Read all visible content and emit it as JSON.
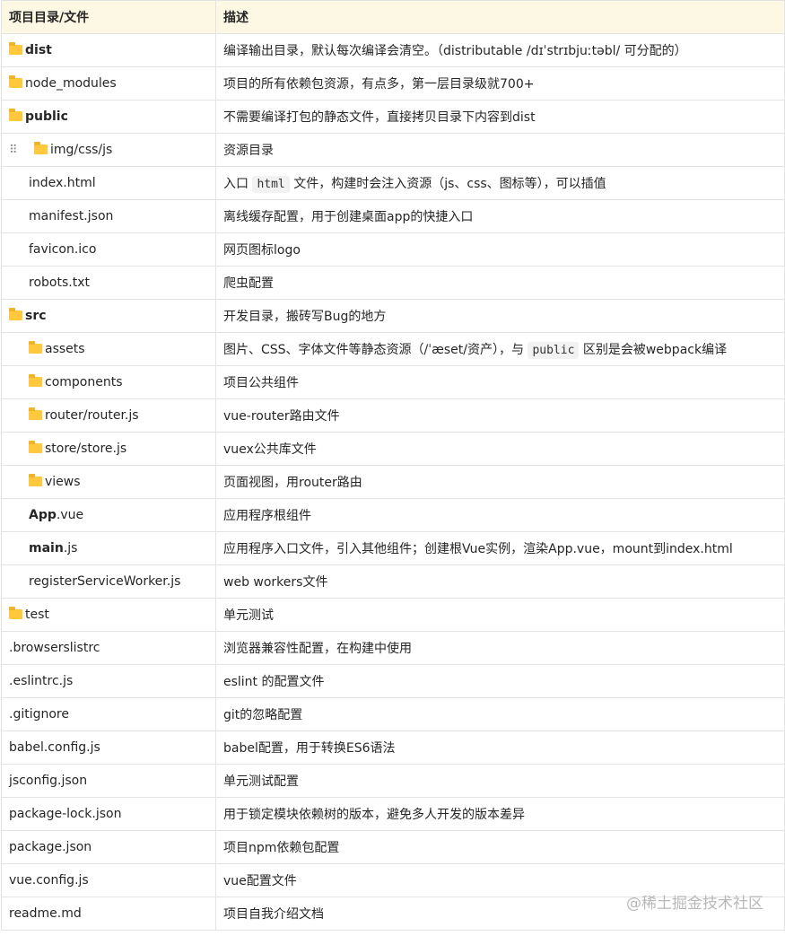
{
  "header": {
    "col1": "项目目录/文件",
    "col2": "描述"
  },
  "rows": [
    {
      "name": "dist",
      "desc": "编译输出目录，默认每次编译会清空。（distributable /dɪˈstrɪbjuːtəbl/ 可分配的）"
    },
    {
      "name": "node_modules",
      "desc": "项目的所有依赖包资源，有点多，第一层目录级就700+"
    },
    {
      "name": "public",
      "desc": "不需要编译打包的静态文件，直接拷贝目录下内容到dist"
    },
    {
      "name": "img/css/js",
      "desc": "资源目录"
    },
    {
      "name": "index.html",
      "desc_a": "入口",
      "desc_code": "html",
      "desc_b": "文件，构建时会注入资源（js、css、图标等），可以插值"
    },
    {
      "name": "manifest.json",
      "desc": "离线缓存配置，用于创建桌面app的快捷入口"
    },
    {
      "name": "favicon.ico",
      "desc": "网页图标logo"
    },
    {
      "name": "robots.txt",
      "desc": "爬虫配置"
    },
    {
      "name": "src",
      "desc": "开发目录，搬砖写Bug的地方"
    },
    {
      "name": "assets",
      "desc_a": "图片、CSS、字体文件等静态资源（/ˈæset/资产），与",
      "desc_code": "public",
      "desc_b": "区别是会被webpack编译"
    },
    {
      "name": "components",
      "desc": "项目公共组件"
    },
    {
      "name": "router/router.js",
      "desc": "vue-router路由文件"
    },
    {
      "name": "store/store.js",
      "desc": "vuex公共库文件"
    },
    {
      "name": "views",
      "desc": "页面视图，用router路由"
    },
    {
      "name_a": "App",
      "name_b": ".vue",
      "desc": "应用程序根组件"
    },
    {
      "name_a": "main",
      "name_b": ".js",
      "desc": "应用程序入口文件，引入其他组件；创建根Vue实例，渲染App.vue，mount到index.html"
    },
    {
      "name": "registerServiceWorker.js",
      "desc": "web workers文件"
    },
    {
      "name": "test",
      "desc": "单元测试"
    },
    {
      "name": ".browserslistrc",
      "desc": "浏览器兼容性配置，在构建中使用"
    },
    {
      "name": ".eslintrc.js",
      "desc": "eslint 的配置文件"
    },
    {
      "name": ".gitignore",
      "desc": "git的忽略配置"
    },
    {
      "name": "babel.config.js",
      "desc": "babel配置，用于转换ES6语法"
    },
    {
      "name": "jsconfig.json",
      "desc": "单元测试配置"
    },
    {
      "name": "package-lock.json",
      "desc": "用于锁定模块依赖树的版本，避免多人开发的版本差异"
    },
    {
      "name": "package.json",
      "desc": "项目npm依赖包配置"
    },
    {
      "name": "vue.config.js",
      "desc": "vue配置文件"
    },
    {
      "name": "readme.md",
      "desc": "项目自我介绍文档"
    }
  ],
  "drag_handle": "⠿",
  "watermark": "@稀土掘金技术社区"
}
